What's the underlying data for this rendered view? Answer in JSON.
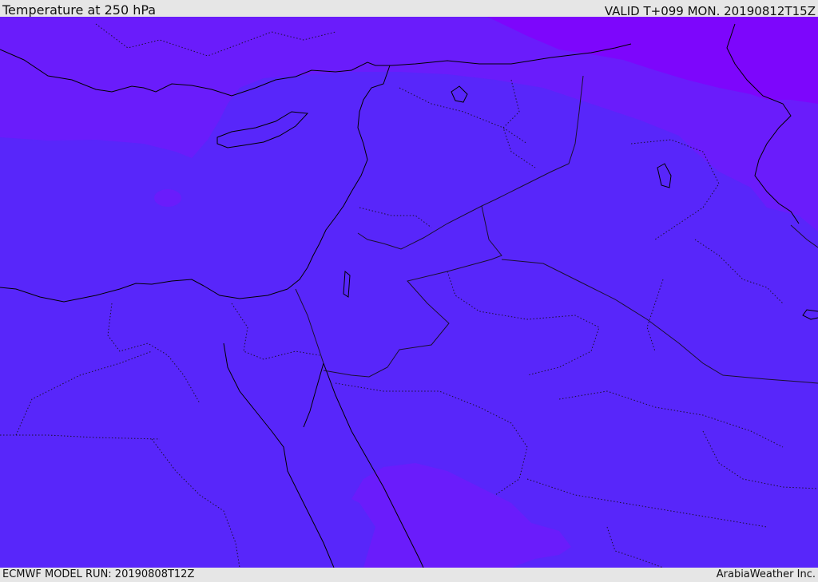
{
  "header": {
    "title": "Temperature at 250 hPa",
    "valid": "VALID T+099 MON. 20190812T15Z"
  },
  "footer": {
    "model_run": "ECMWF MODEL RUN: 20190808T12Z",
    "credit": "ArabiaWeather Inc."
  },
  "colors": {
    "base": "#5826fa",
    "warm_band": "#6a1cfb",
    "warmer_band": "#7d06fc",
    "coastline": "#000000",
    "border": "#1a1030"
  }
}
